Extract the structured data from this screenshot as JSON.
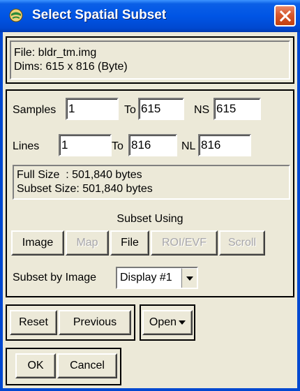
{
  "window": {
    "title": "Select Spatial Subset",
    "icon": "globe-icon",
    "close_icon": "close-icon",
    "accent": "#0055e5"
  },
  "file_info": {
    "file": "File: bldr_tm.img",
    "dims": "Dims: 615 x 816 (Byte)"
  },
  "samples": {
    "label": "Samples",
    "start": "1",
    "to_label": "To",
    "end": "615",
    "ns_label": "NS",
    "ns": "615"
  },
  "lines": {
    "label": "Lines",
    "start": "1",
    "to_label": "To",
    "end": "816",
    "nl_label": "NL",
    "nl": "816"
  },
  "size_info": {
    "full": "Full Size  : 501,840 bytes",
    "subset": "Subset Size: 501,840 bytes"
  },
  "subset_using": {
    "label": "Subset Using",
    "buttons": {
      "image": "Image",
      "map": "Map",
      "file": "File",
      "roi": "ROI/EVF",
      "scroll": "Scroll"
    }
  },
  "subset_by_image": {
    "label": "Subset by Image",
    "selected": "Display #1"
  },
  "actions": {
    "reset": "Reset",
    "previous": "Previous",
    "open": "Open",
    "ok": "OK",
    "cancel": "Cancel"
  }
}
